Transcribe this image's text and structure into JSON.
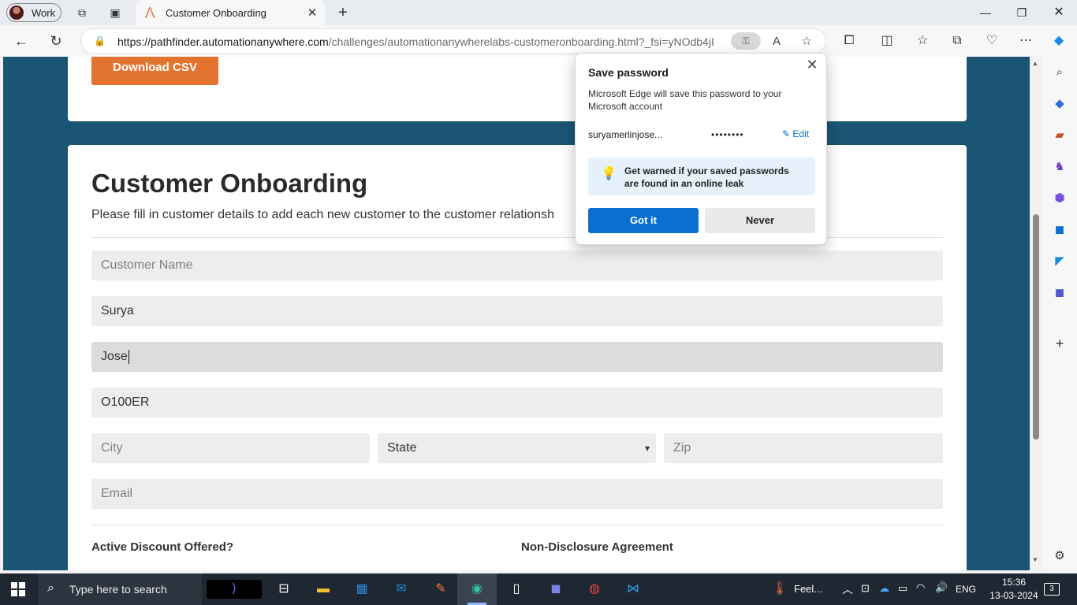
{
  "browser": {
    "profile_label": "Work",
    "tab_title": "Customer Onboarding",
    "url_host": "https://pathfinder.automationanywhere.com",
    "url_path": "/challenges/automationanywherelabs-customeronboarding.html?_fsi=yNOdb4jI"
  },
  "page": {
    "download_label": "Download CSV",
    "title": "Customer Onboarding",
    "description": "Please fill in customer details to add each new customer to the customer relationsh",
    "fields": {
      "customer_name_placeholder": "Customer Name",
      "first_name_value": "Surya",
      "last_name_value": "Jose",
      "customer_id_value": "O100ER",
      "city_placeholder": "City",
      "state_value": "State",
      "zip_placeholder": "Zip",
      "email_placeholder": "Email"
    },
    "labels": {
      "discount": "Active Discount Offered?",
      "nda": "Non-Disclosure Agreement"
    }
  },
  "save_password_popup": {
    "title": "Save password",
    "text": "Microsoft Edge will save this password to your Microsoft account",
    "username": "suryamerlinjose...",
    "password_mask": "••••••••",
    "edit_label": "Edit",
    "warning": "Get warned if your saved passwords are found in an online leak",
    "got_it_label": "Got it",
    "never_label": "Never"
  },
  "taskbar": {
    "search_text": "Type here to search",
    "weather_text": "Feel...",
    "language": "ENG",
    "time": "15:36",
    "date": "13-03-2024",
    "notifications": "3"
  },
  "colors": {
    "page_bg": "#1b5574",
    "accent_orange": "#e27430",
    "edge_blue": "#0a6fd1"
  }
}
